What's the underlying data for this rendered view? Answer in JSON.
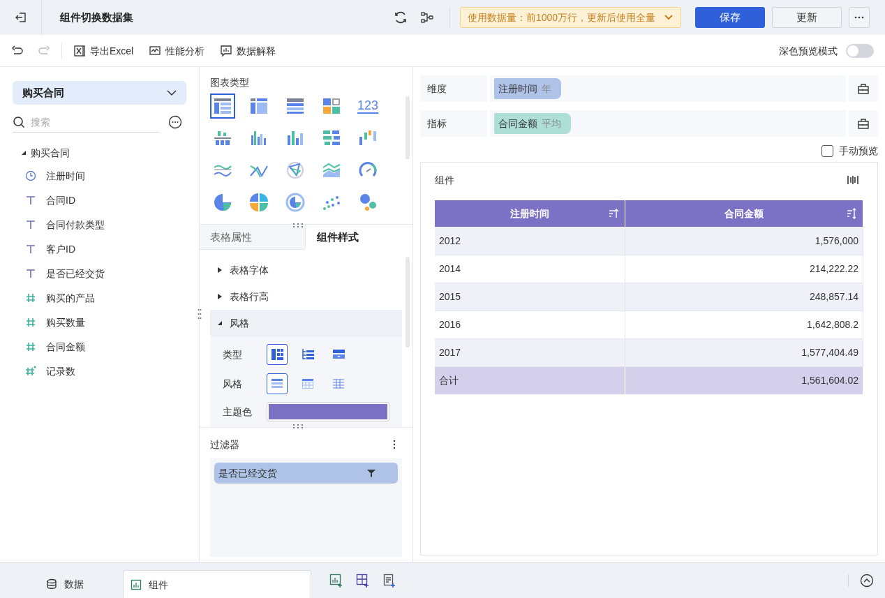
{
  "header": {
    "title": "组件切换数据集",
    "notice": "使用数据量：前1000万行，更新后使用全量",
    "buttons": [
      {
        "label": "保存",
        "kind": "primary"
      },
      {
        "label": "更新",
        "kind": "default"
      }
    ]
  },
  "toolbar": {
    "items": [
      {
        "label": "导出Excel",
        "kind": "excel"
      },
      {
        "label": "性能分析",
        "kind": "perf"
      },
      {
        "label": "数据解释",
        "kind": "explain"
      }
    ],
    "dark_mode": {
      "label": "深色预览模式",
      "on": false
    }
  },
  "dataset": {
    "selected": "购买合同",
    "search_placeholder": "搜索"
  },
  "tree": {
    "label": "购买合同",
    "expanded": true,
    "children": [
      {
        "label": "注册时间",
        "kind": "date"
      },
      {
        "label": "合同ID",
        "kind": "text"
      },
      {
        "label": "合同付款类型",
        "kind": "text"
      },
      {
        "label": "客户ID",
        "kind": "text"
      },
      {
        "label": "是否已经交货",
        "kind": "text"
      },
      {
        "label": "购买的产品",
        "kind": "number"
      },
      {
        "label": "购买数量",
        "kind": "number"
      },
      {
        "label": "合同金额",
        "kind": "number"
      },
      {
        "label": "记录数",
        "kind": "count"
      }
    ]
  },
  "chart_types": {
    "title": "图表类型",
    "items": [
      {
        "kind": "table",
        "selected": true
      },
      {
        "kind": "crosstab",
        "selected": false
      },
      {
        "kind": "detail",
        "selected": false
      },
      {
        "kind": "cards",
        "selected": false
      },
      {
        "kind": "number",
        "label": "123",
        "selected": false
      },
      {
        "kind": "hbar-stack",
        "selected": false
      },
      {
        "kind": "bars-multi",
        "selected": false
      },
      {
        "kind": "bars",
        "selected": false
      },
      {
        "kind": "hbars",
        "selected": false
      },
      {
        "kind": "waterfall",
        "selected": false
      },
      {
        "kind": "lines",
        "selected": false
      },
      {
        "kind": "cross-lines",
        "selected": false
      },
      {
        "kind": "radar",
        "selected": false
      },
      {
        "kind": "area",
        "selected": false
      },
      {
        "kind": "gauge",
        "selected": false
      },
      {
        "kind": "pie",
        "selected": false
      },
      {
        "kind": "pie-multi",
        "selected": false
      },
      {
        "kind": "ring",
        "selected": false
      },
      {
        "kind": "scatter",
        "selected": false
      },
      {
        "kind": "bubble",
        "selected": false
      }
    ]
  },
  "property_tabs": [
    {
      "label": "表格属性",
      "selected": false
    },
    {
      "label": "组件样式",
      "selected": true
    }
  ],
  "sections": [
    {
      "label": "表格字体",
      "expanded": false
    },
    {
      "label": "表格行高",
      "expanded": false
    },
    {
      "label": "风格",
      "expanded": true
    }
  ],
  "style": {
    "type": {
      "label": "类型",
      "options": [
        {
          "kind": "group",
          "selected": true
        },
        {
          "kind": "tree",
          "selected": false
        },
        {
          "kind": "flat",
          "selected": false
        }
      ]
    },
    "look": {
      "label": "风格",
      "options": [
        {
          "kind": "striped",
          "selected": true
        },
        {
          "kind": "grid",
          "selected": false
        },
        {
          "kind": "lines",
          "selected": false
        }
      ]
    },
    "theme_color": {
      "label": "主题色",
      "color": "#7b72c6"
    }
  },
  "filter": {
    "title": "过滤器",
    "items": [
      {
        "label": "是否已经交货"
      }
    ]
  },
  "dimension": {
    "label": "维度",
    "fields": [
      {
        "name": "注册时间",
        "detail": "年"
      }
    ]
  },
  "measure": {
    "label": "指标",
    "fields": [
      {
        "name": "合同金额",
        "detail": "平均"
      }
    ]
  },
  "manual_preview": {
    "label": "手动预览",
    "checked": false
  },
  "component": {
    "title": "组件",
    "table": {
      "columns": [
        {
          "label": "注册时间",
          "kind": "sorted"
        },
        {
          "label": "合同金额",
          "kind": "sortable"
        }
      ],
      "rows": [
        [
          "2012",
          "1,576,000"
        ],
        [
          "2014",
          "214,222.22"
        ],
        [
          "2015",
          "248,857.14"
        ],
        [
          "2016",
          "1,642,808.2"
        ],
        [
          "2017",
          "1,577,404.49"
        ]
      ],
      "total": [
        "合计",
        "1,561,604.02"
      ]
    }
  },
  "bottom_tabs": [
    {
      "label": "数据",
      "kind": "data",
      "selected": false
    },
    {
      "label": "组件",
      "kind": "component",
      "selected": true
    }
  ]
}
